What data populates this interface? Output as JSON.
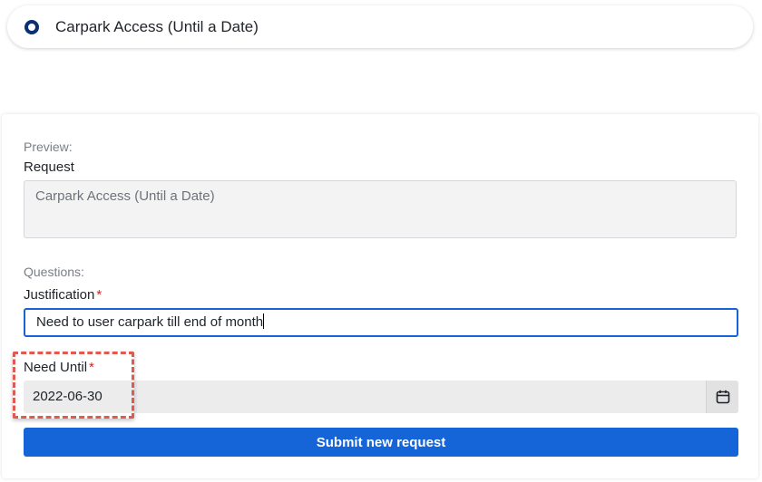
{
  "option": {
    "title": "Carpark Access (Until a Date)",
    "selected": true
  },
  "preview": {
    "heading": "Preview:",
    "request_label": "Request",
    "request_value": "Carpark Access (Until a Date)"
  },
  "questions": {
    "heading": "Questions:",
    "justification_label": "Justification",
    "justification_value": "Need to user carpark till end of month",
    "need_until_label": "Need Until",
    "need_until_value": "2022-06-30",
    "required_marker": "*"
  },
  "actions": {
    "submit_label": "Submit new request"
  },
  "icons": {
    "calendar": "calendar-icon",
    "radio": "radio-selected-icon"
  },
  "colors": {
    "primary": "#1565d8",
    "radio": "#0b2f73",
    "required": "#c62828",
    "highlight": "#e05a4f"
  }
}
